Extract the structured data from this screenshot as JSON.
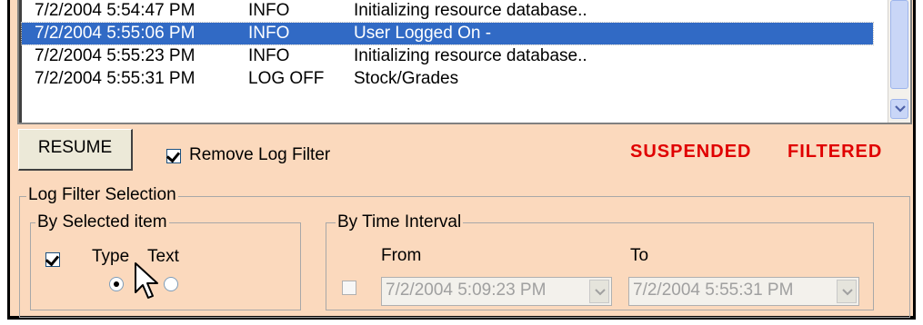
{
  "log": {
    "rows": [
      {
        "datetime": "7/2/2004 5:54:47 PM",
        "type": "INFO",
        "text": "Initializing resource database..",
        "selected": false
      },
      {
        "datetime": "7/2/2004 5:55:06 PM",
        "type": "INFO",
        "text": "User Logged On -",
        "selected": true
      },
      {
        "datetime": "7/2/2004 5:55:23 PM",
        "type": "INFO",
        "text": "Initializing resource database..",
        "selected": false
      },
      {
        "datetime": "7/2/2004 5:55:31 PM",
        "type": "LOG OFF",
        "text": "Stock/Grades",
        "selected": false
      }
    ]
  },
  "controls": {
    "resume_label": "RESUME",
    "remove_filter_label": "Remove Log Filter",
    "remove_filter_checked": true
  },
  "status": {
    "suspended": "SUSPENDED",
    "filtered": "FILTERED",
    "color": "#e00000"
  },
  "filter": {
    "group_title": "Log Filter Selection",
    "by_item": {
      "title": "By Selected item",
      "checked": true,
      "type_label": "Type",
      "text_label": "Text",
      "selected_option": "Type"
    },
    "by_time": {
      "title": "By Time Interval",
      "enabled": false,
      "from_label": "From",
      "to_label": "To",
      "from_value": "7/2/2004 5:09:23 PM",
      "to_value": "7/2/2004 5:55:31 PM"
    }
  },
  "icons": {
    "scroll_down": "chevron-down-icon",
    "combo_arrow": "dropdown-arrow-icon",
    "cursor": "mouse-pointer-icon"
  },
  "colors": {
    "panel_bg": "#fbd9bd",
    "selection": "#316ac5"
  }
}
